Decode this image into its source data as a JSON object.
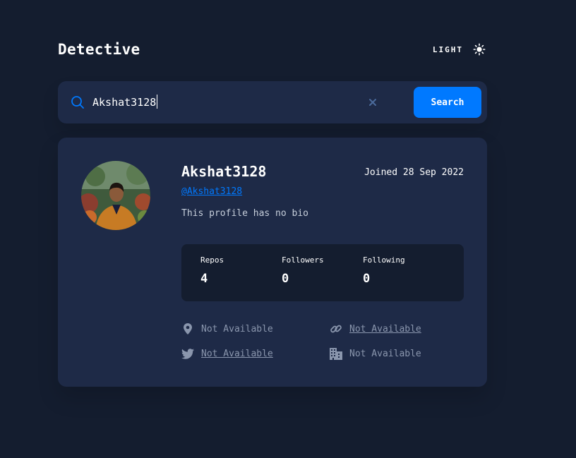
{
  "header": {
    "logo": "Detective",
    "theme_label": "LIGHT",
    "theme_icon": "sun-icon"
  },
  "search": {
    "icon": "search-icon",
    "value": "Akshat3128",
    "clear_icon": "close-icon",
    "button_label": "Search"
  },
  "profile": {
    "name": "Akshat3128",
    "username": "@Akshat3128",
    "joined": "Joined 28 Sep 2022",
    "bio": "This profile has no bio",
    "stats": [
      {
        "label": "Repos",
        "value": "4"
      },
      {
        "label": "Followers",
        "value": "0"
      },
      {
        "label": "Following",
        "value": "0"
      }
    ],
    "links": {
      "location": {
        "icon": "location-pin-icon",
        "text": "Not Available"
      },
      "website": {
        "icon": "link-icon",
        "text": "Not Available"
      },
      "twitter": {
        "icon": "twitter-icon",
        "text": "Not Available"
      },
      "company": {
        "icon": "building-icon",
        "text": "Not Available"
      }
    }
  },
  "colors": {
    "background": "#141d2f",
    "card": "#1e2a47",
    "accent": "#0079ff",
    "muted_text": "#8a96ad"
  }
}
